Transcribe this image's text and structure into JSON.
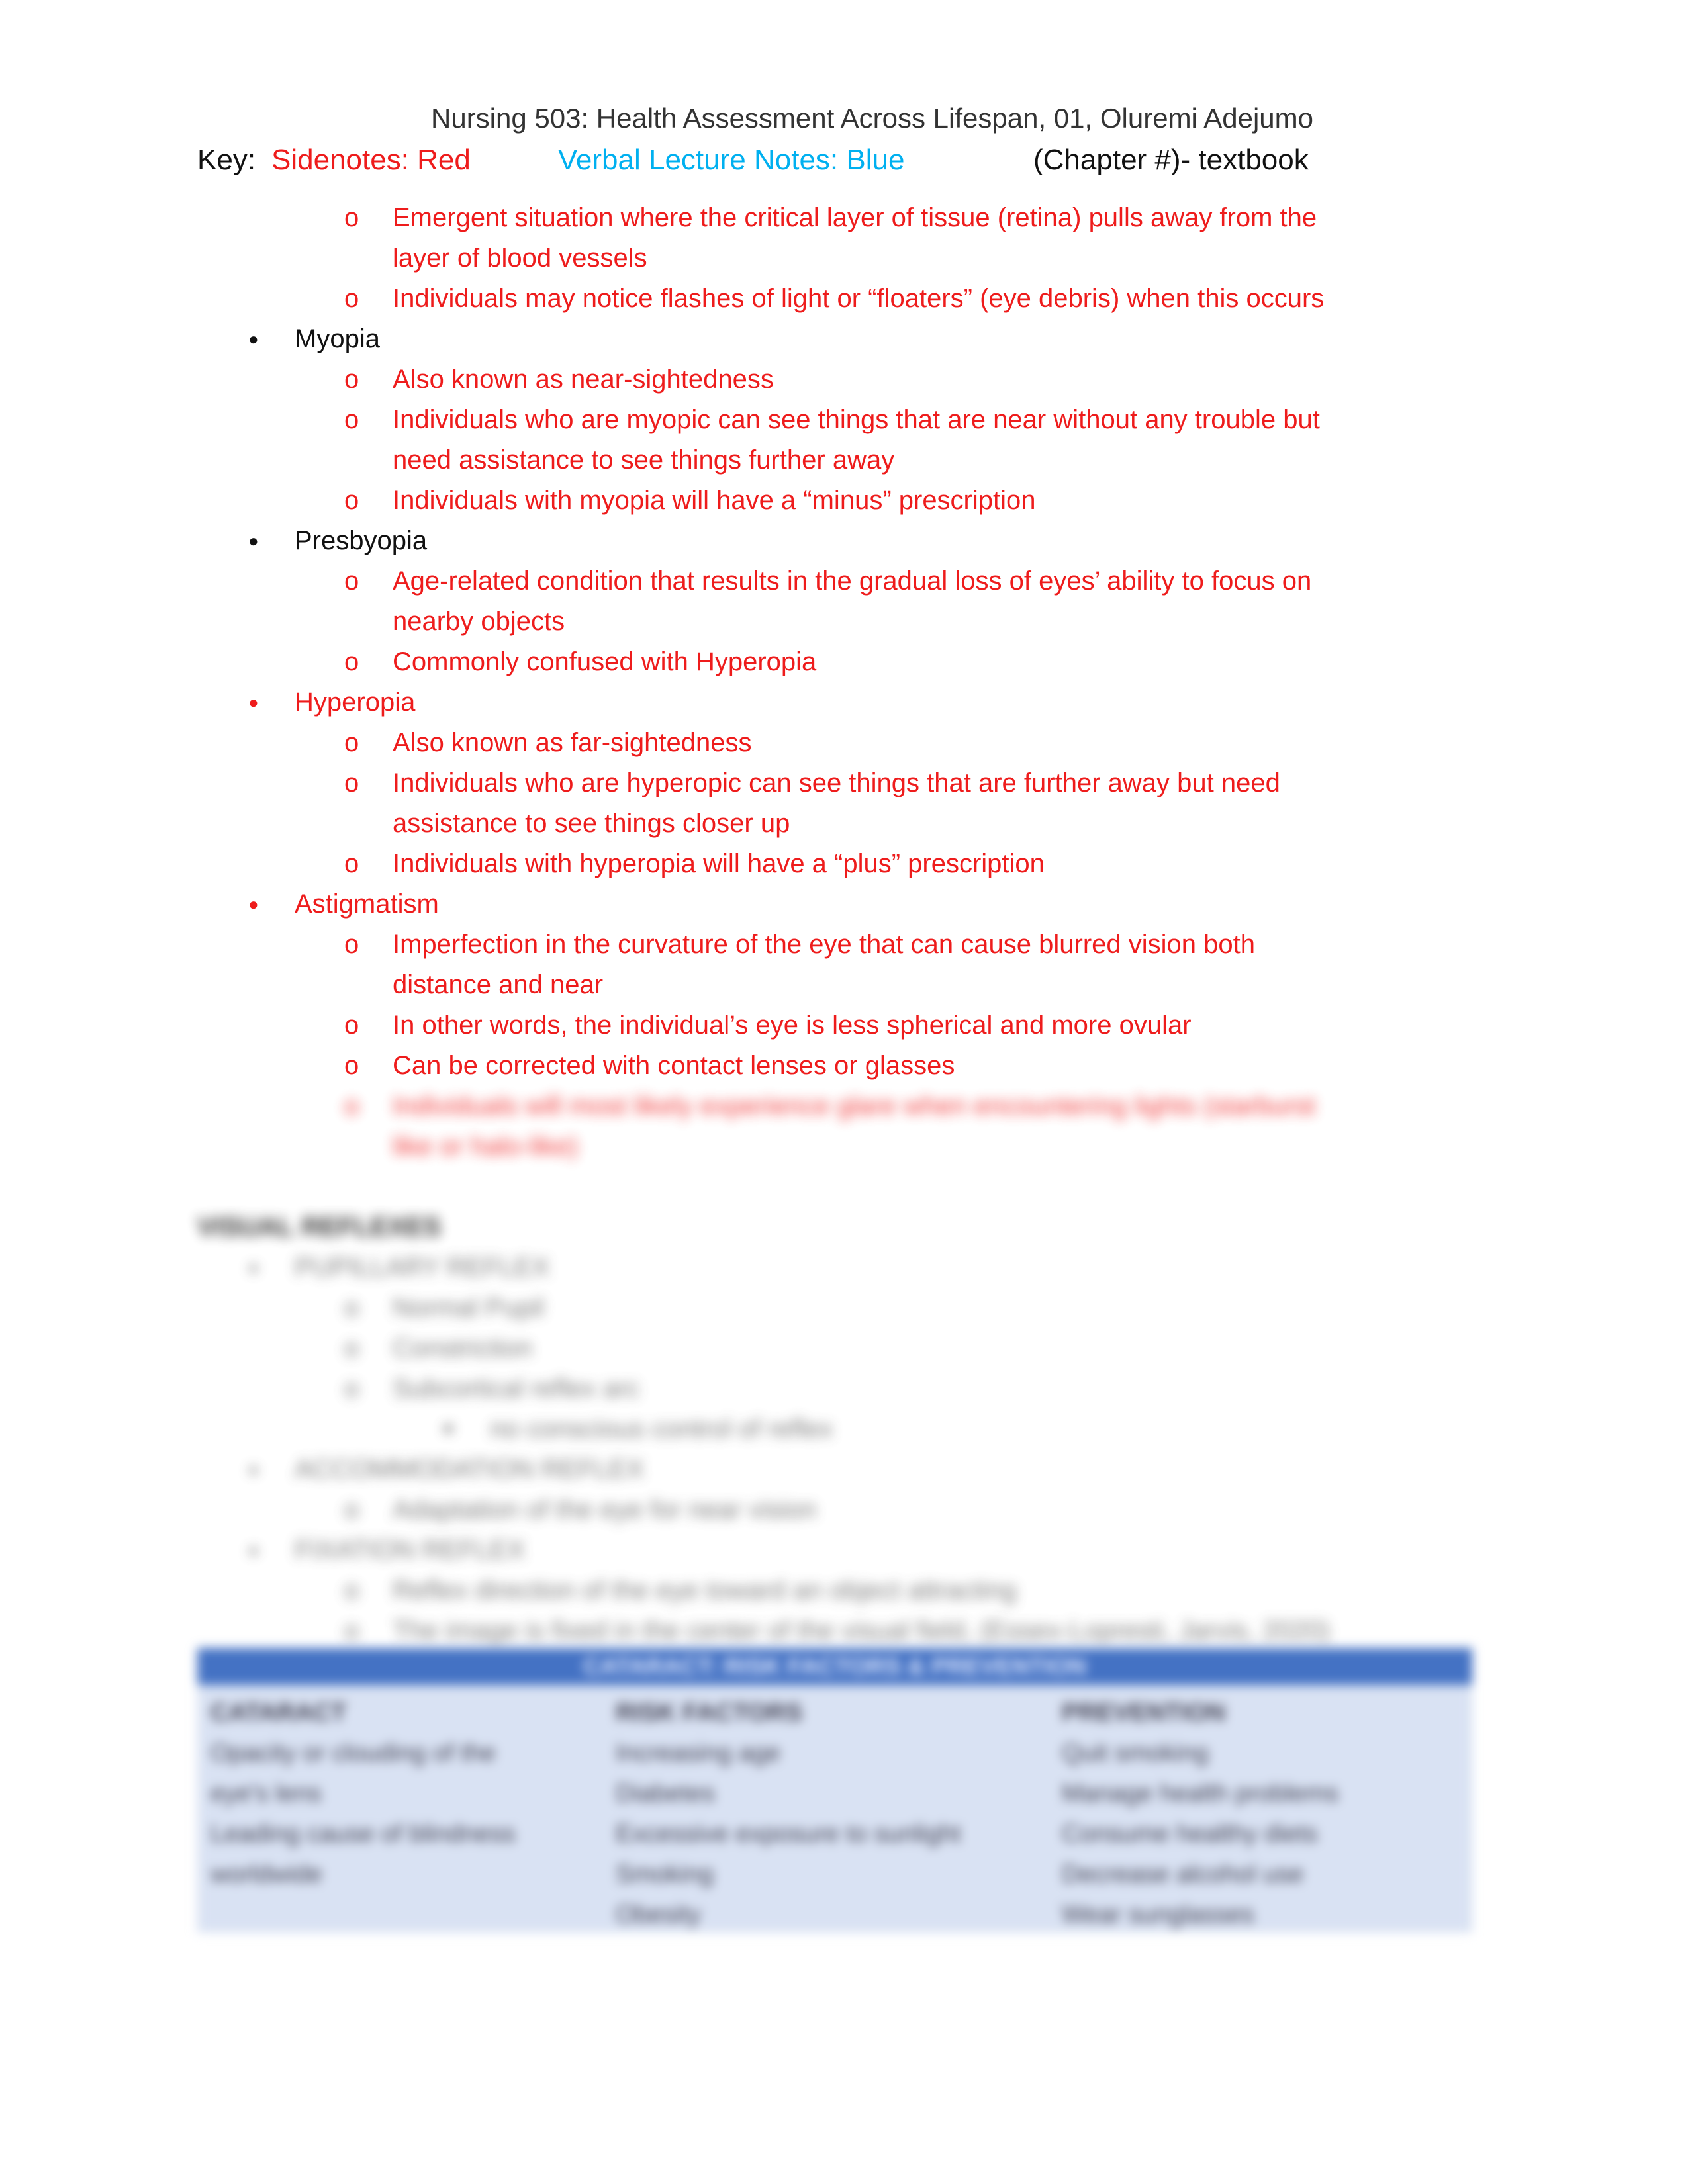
{
  "header": {
    "title": "Nursing 503: Health Assessment Across Lifespan, 01, Oluremi Adejumo"
  },
  "key": {
    "label": "Key:",
    "sidenotes": "Sidenotes: Red",
    "verbal": "Verbal Lecture Notes: Blue",
    "chapter": "(Chapter #)- textbook",
    "colors": {
      "sidenotes": "#ee1c1c",
      "verbal": "#00b0f0",
      "text": "#111111"
    }
  },
  "lines": [
    {
      "level": 2,
      "color": "red",
      "text": "Emergent situation where the critical layer of tissue (retina) pulls away from the"
    },
    {
      "level": 2,
      "color": "red",
      "cont": true,
      "text": "layer of blood vessels"
    },
    {
      "level": 2,
      "color": "red",
      "text": "Individuals may notice flashes of light or “floaters” (eye debris) when this occurs"
    },
    {
      "level": 1,
      "color": "black",
      "text": "Myopia"
    },
    {
      "level": 2,
      "color": "red",
      "text": "Also known as near-sightedness"
    },
    {
      "level": 2,
      "color": "red",
      "text": "Individuals who are myopic can see things that are near without any trouble but"
    },
    {
      "level": 2,
      "color": "red",
      "cont": true,
      "text": "need assistance to see things further away"
    },
    {
      "level": 2,
      "color": "red",
      "text": "Individuals with myopia will have a “minus” prescription"
    },
    {
      "level": 1,
      "color": "black",
      "text": "Presbyopia"
    },
    {
      "level": 2,
      "color": "red",
      "text": "Age-related condition that results in the gradual loss of eyes’ ability to focus on"
    },
    {
      "level": 2,
      "color": "red",
      "cont": true,
      "text": "nearby objects"
    },
    {
      "level": 2,
      "color": "red",
      "text": "Commonly confused with Hyperopia"
    },
    {
      "level": 1,
      "color": "red",
      "text": "Hyperopia"
    },
    {
      "level": 2,
      "color": "red",
      "text": "Also known as far-sightedness"
    },
    {
      "level": 2,
      "color": "red",
      "text": "Individuals who are hyperopic can see things that are further away but need"
    },
    {
      "level": 2,
      "color": "red",
      "cont": true,
      "text": "assistance to see things closer up"
    },
    {
      "level": 2,
      "color": "red",
      "text": "Individuals with hyperopia will have a “plus” prescription"
    },
    {
      "level": 1,
      "color": "red",
      "text": "Astigmatism"
    },
    {
      "level": 2,
      "color": "red",
      "text": "Imperfection in the curvature of the eye that can cause blurred vision both"
    },
    {
      "level": 2,
      "color": "red",
      "cont": true,
      "text": "distance and near"
    },
    {
      "level": 2,
      "color": "red",
      "text": "In other words, the individual’s eye is less spherical and more ovular"
    },
    {
      "level": 2,
      "color": "red",
      "text": "Can be corrected with contact lenses or glasses"
    },
    {
      "level": 2,
      "color": "red",
      "blur": true,
      "text": "Individuals will most likely experience glare when encountering lights (starburst"
    },
    {
      "level": 2,
      "color": "red",
      "blur": true,
      "cont": true,
      "text": "like or halo-like)"
    },
    {
      "level": 0,
      "color": "black",
      "blur": true,
      "skip": true,
      "text": "VISUAL REFLEXES"
    },
    {
      "level": 1,
      "color": "gray",
      "blur": true,
      "text": "PUPILLARY REFLEX"
    },
    {
      "level": 2,
      "color": "gray",
      "blur": true,
      "text": "Normal Pupil"
    },
    {
      "level": 2,
      "color": "gray",
      "blur": true,
      "text": "Constriction"
    },
    {
      "level": 2,
      "color": "gray",
      "blur": true,
      "text": "Subcortical reflex arc"
    },
    {
      "level": 3,
      "color": "gray",
      "blur": true,
      "text": "no conscious control of reflex"
    },
    {
      "level": 1,
      "color": "gray",
      "blur": true,
      "text": "ACCOMMODATION REFLEX"
    },
    {
      "level": 2,
      "color": "gray",
      "blur": true,
      "text": "Adaptation of the eye for near vision"
    },
    {
      "level": 1,
      "color": "gray",
      "blur": true,
      "text": "FIXATION REFLEX"
    },
    {
      "level": 2,
      "color": "gray",
      "blur": true,
      "text": "Reflex direction of the eye toward an object attracting"
    },
    {
      "level": 2,
      "color": "gray",
      "blur": true,
      "text": "The image is fixed in the center of the visual field, (Essex-Lopresti, Jarvis, 2020)"
    }
  ],
  "table": {
    "title": "CATARACT: RISK FACTORS & PREVENTION",
    "header_color": "#4472c4",
    "body_color": "#d9e2f3",
    "columns": [
      {
        "header": "CATARACT",
        "items": [
          "Opacity or clouding of the",
          "eye's lens",
          "Leading cause of blindness",
          "worldwide"
        ]
      },
      {
        "header": "RISK FACTORS",
        "items": [
          "Increasing age",
          "Diabetes",
          "Excessive exposure to sunlight",
          "Smoking",
          "Obesity"
        ]
      },
      {
        "header": "PREVENTION",
        "items": [
          "Quit smoking",
          "Manage health problems",
          "Consume healthy diets",
          "Decrease alcohol use",
          "Wear sunglasses"
        ]
      }
    ]
  }
}
